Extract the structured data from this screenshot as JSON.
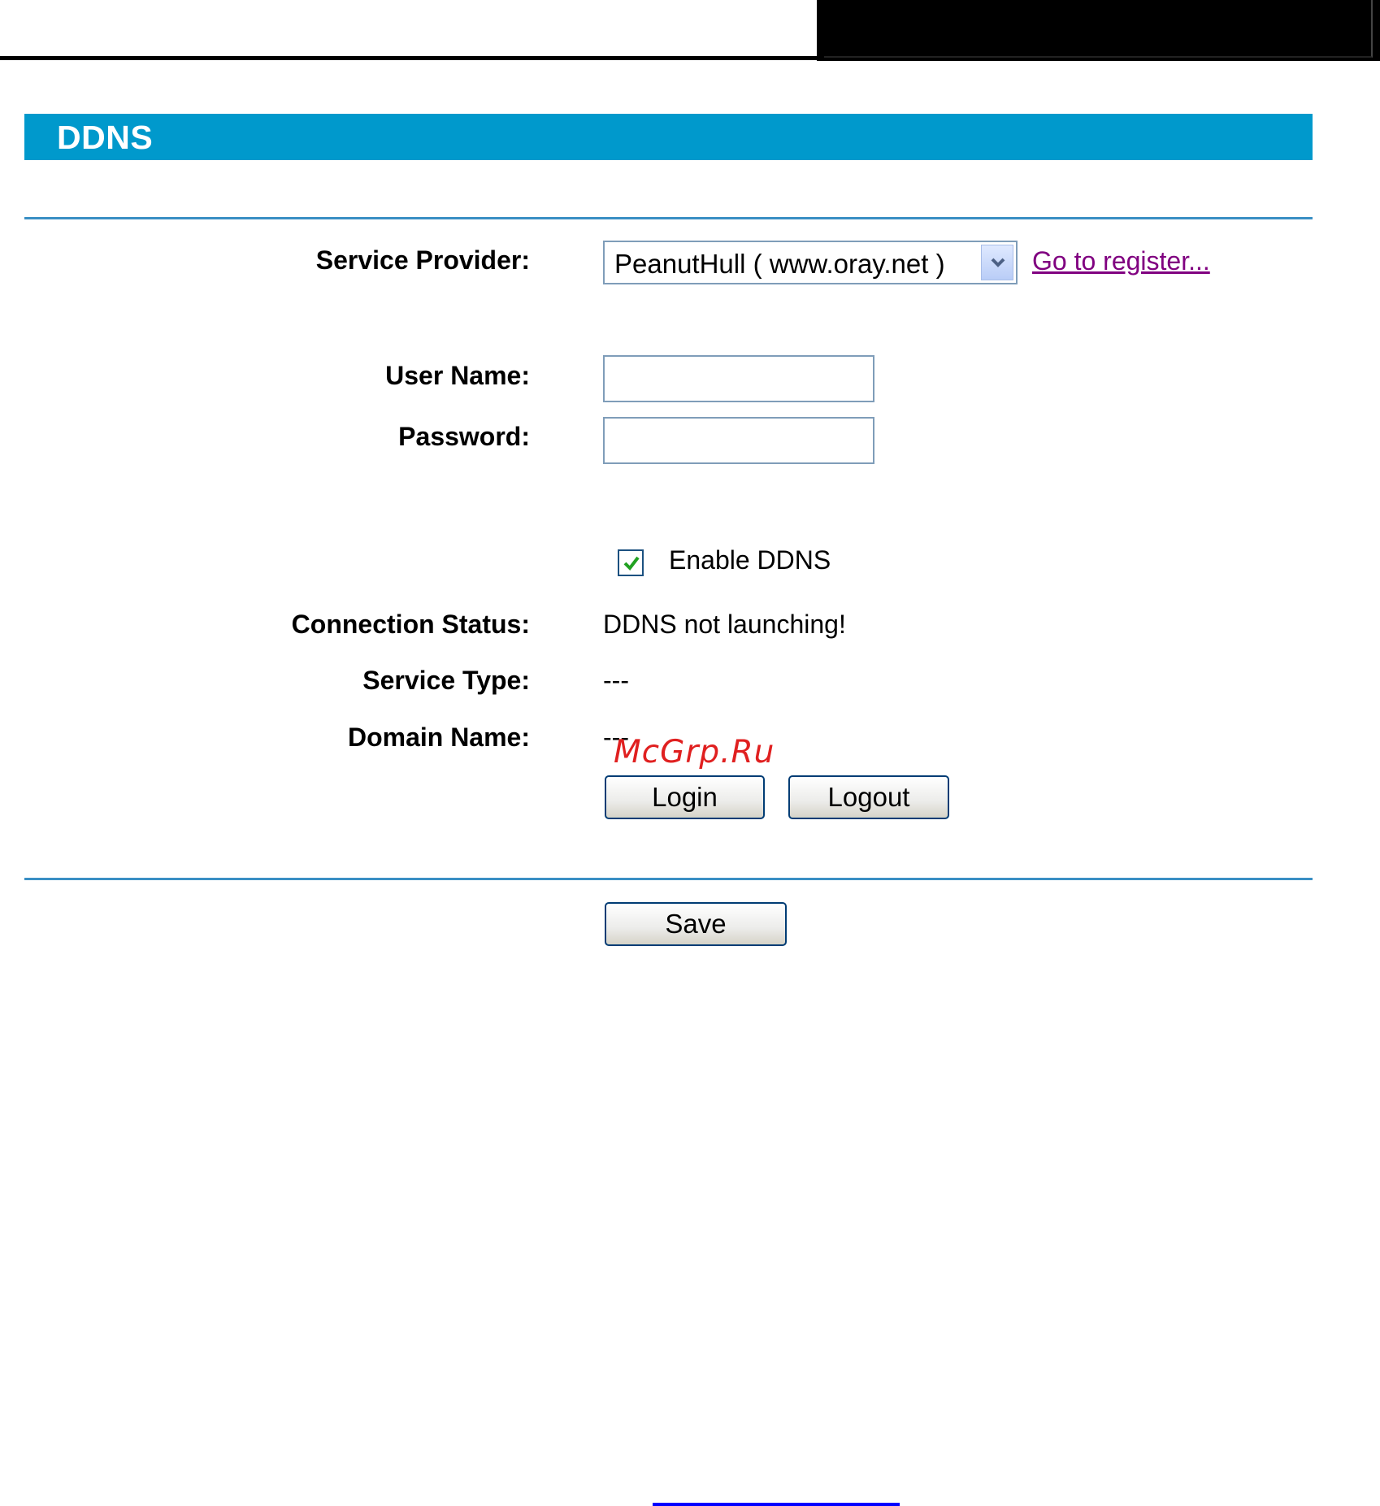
{
  "title": "DDNS",
  "form": {
    "service_provider_label": "Service Provider:",
    "service_provider_value": "PeanutHull ( www.oray.net )",
    "register_link": "Go to register...",
    "username_label": "User Name:",
    "username_value": "",
    "password_label": "Password:",
    "password_value": "",
    "enable_label": "Enable DDNS",
    "enable_checked": true,
    "connection_status_label": "Connection Status:",
    "connection_status_value": "DDNS not launching!",
    "service_type_label": "Service Type:",
    "service_type_value": "---",
    "domain_name_label": "Domain Name:",
    "domain_name_value": "---"
  },
  "buttons": {
    "login": "Login",
    "logout": "Logout",
    "save": "Save"
  },
  "watermark": "McGrp.Ru",
  "colors": {
    "title_bar": "#0099cc",
    "rule": "#3a8fc4",
    "link": "#800080",
    "watermark": "#e02020"
  },
  "icons": {
    "dropdown": "chevron-down-icon",
    "check": "checkmark-icon"
  }
}
